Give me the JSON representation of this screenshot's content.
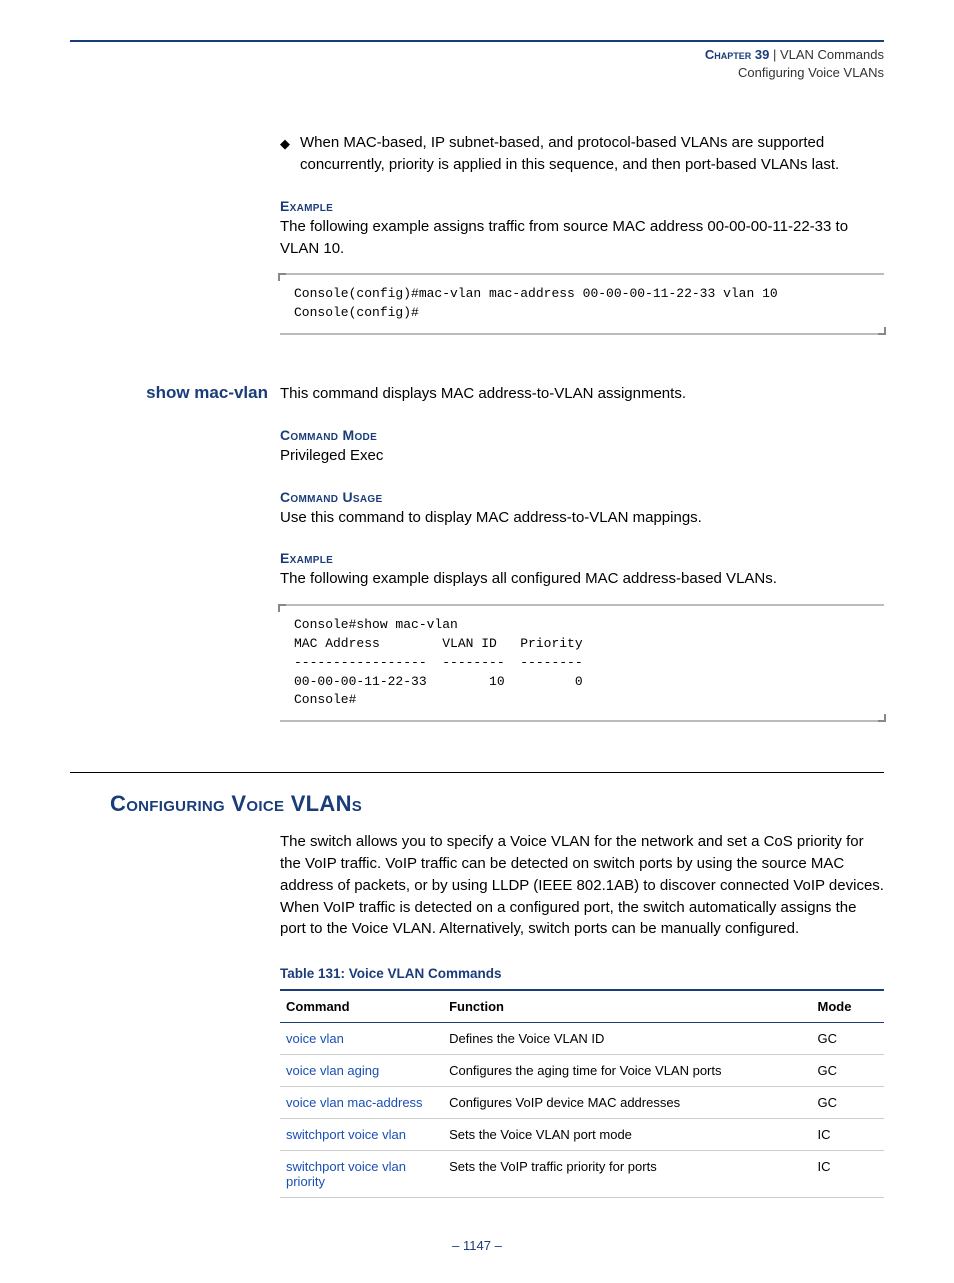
{
  "header": {
    "chapter_label": "Chapter 39",
    "pipe": "  |  ",
    "title": "VLAN Commands",
    "subtitle": "Configuring Voice VLANs"
  },
  "bullet1": "When MAC-based, IP subnet-based, and protocol-based VLANs are supported concurrently, priority is applied in this sequence, and then port-based VLANs last.",
  "labels": {
    "example": "Example",
    "command_mode": "Command Mode",
    "command_usage": "Command Usage"
  },
  "example1_text": "The following example assigns traffic from source MAC address 00-00-00-11-22-33 to VLAN 10.",
  "code1": "Console(config)#mac-vlan mac-address 00-00-00-11-22-33 vlan 10\nConsole(config)#",
  "cmd1": {
    "name": "show mac-vlan",
    "desc": "This command displays MAC address-to-VLAN assignments.",
    "mode": "Privileged Exec",
    "usage": "Use this command to display MAC address-to-VLAN mappings.",
    "example_text": "The following example displays all configured MAC address-based VLANs."
  },
  "chart_data": {
    "type": "table",
    "title": "show mac-vlan output",
    "columns": [
      "MAC Address",
      "VLAN ID",
      "Priority"
    ],
    "rows": [
      [
        "00-00-00-11-22-33",
        10,
        0
      ]
    ]
  },
  "code2": "Console#show mac-vlan\nMAC Address        VLAN ID   Priority\n-----------------  --------  --------\n00-00-00-11-22-33        10         0\nConsole#",
  "section2": {
    "heading": "Configuring Voice VLANs",
    "intro": "The switch allows you to specify a Voice VLAN for the network and set a CoS priority for the VoIP traffic. VoIP traffic can be detected on switch ports by using the source MAC address of packets, or by using LLDP (IEEE 802.1AB) to discover connected VoIP devices. When VoIP traffic is detected on a configured port, the switch automatically assigns the port to the Voice VLAN. Alternatively, switch ports can be manually configured."
  },
  "table": {
    "caption": "Table 131: Voice VLAN Commands",
    "headers": {
      "command": "Command",
      "function": "Function",
      "mode": "Mode"
    },
    "rows": [
      {
        "command": "voice vlan",
        "function": "Defines the Voice VLAN ID",
        "mode": "GC"
      },
      {
        "command": "voice vlan aging",
        "function": "Configures the aging time for Voice VLAN ports",
        "mode": "GC"
      },
      {
        "command": "voice vlan mac-address",
        "function": "Configures VoIP device MAC addresses",
        "mode": "GC"
      },
      {
        "command": "switchport voice vlan",
        "function": "Sets the Voice VLAN port mode",
        "mode": "IC"
      },
      {
        "command": "switchport voice vlan priority",
        "function": "Sets the VoIP traffic priority for ports",
        "mode": "IC"
      }
    ]
  },
  "footer": {
    "page": "1147",
    "dash": "–  ",
    "dash2": "  –"
  }
}
